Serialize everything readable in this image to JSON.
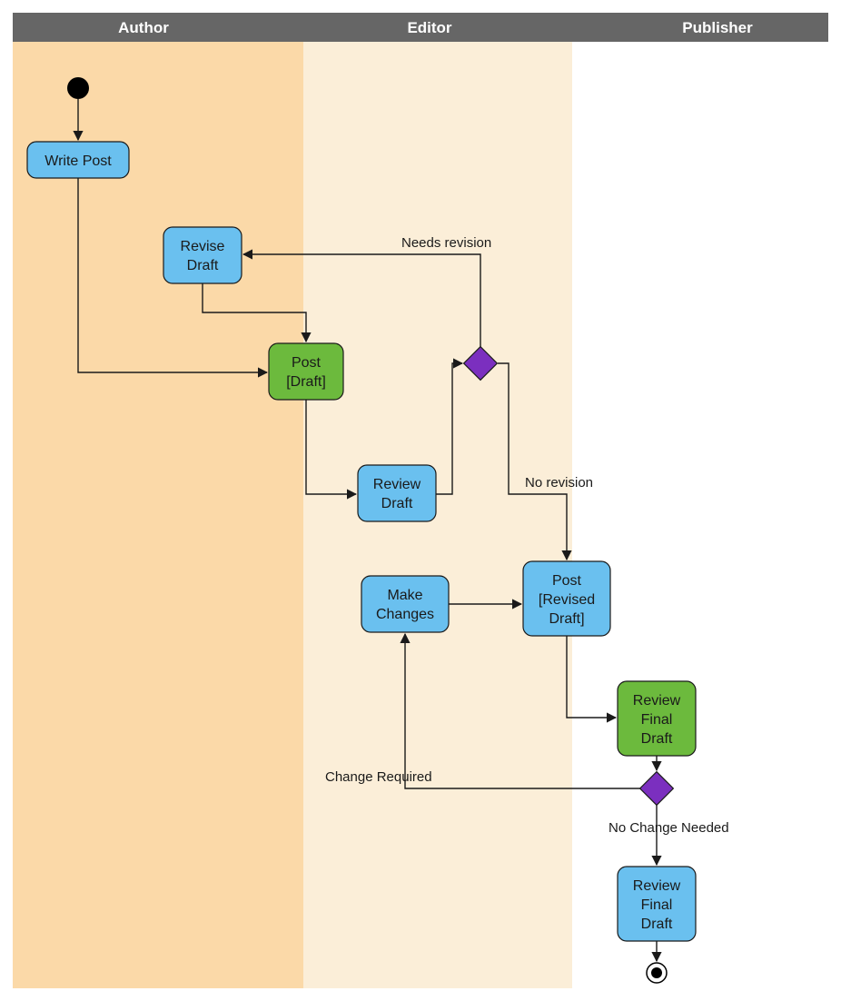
{
  "swimlanes": {
    "author": {
      "label": "Author"
    },
    "editor": {
      "label": "Editor"
    },
    "publisher": {
      "label": "Publisher"
    }
  },
  "nodes": {
    "write_post": {
      "label": "Write Post"
    },
    "revise_draft": {
      "label1": "Revise",
      "label2": "Draft"
    },
    "post_draft": {
      "label1": "Post",
      "label2": "[Draft]"
    },
    "review_draft": {
      "label1": "Review",
      "label2": "Draft"
    },
    "make_changes": {
      "label1": "Make",
      "label2": "Changes"
    },
    "post_revised": {
      "label1": "Post",
      "label2": "[Revised",
      "label3": "Draft]"
    },
    "review_final": {
      "label1": "Review",
      "label2": "Final",
      "label3": "Draft"
    },
    "review_final2": {
      "label1": "Review",
      "label2": "Final",
      "label3": "Draft"
    }
  },
  "edges": {
    "needs_revision": {
      "label": "Needs revision"
    },
    "no_revision": {
      "label": "No revision"
    },
    "change_required": {
      "label": "Change Required"
    },
    "no_change_needed": {
      "label": "No Change Needed"
    }
  },
  "chart_data": {
    "type": "swimlane-activity-diagram",
    "lanes": [
      "Author",
      "Editor",
      "Publisher"
    ],
    "start": {
      "lane": "Author"
    },
    "activities": [
      {
        "id": "write_post",
        "label": "Write Post",
        "lane": "Author",
        "color": "blue"
      },
      {
        "id": "revise_draft",
        "label": "Revise Draft",
        "lane": "Author",
        "color": "blue"
      },
      {
        "id": "post_draft",
        "label": "Post [Draft]",
        "lane": "Author/Editor",
        "color": "green"
      },
      {
        "id": "review_draft",
        "label": "Review Draft",
        "lane": "Editor",
        "color": "blue"
      },
      {
        "id": "decision1",
        "type": "decision",
        "lane": "Editor"
      },
      {
        "id": "make_changes",
        "label": "Make Changes",
        "lane": "Editor",
        "color": "blue"
      },
      {
        "id": "post_revised",
        "label": "Post [Revised Draft]",
        "lane": "Editor",
        "color": "blue"
      },
      {
        "id": "review_final",
        "label": "Review Final Draft",
        "lane": "Publisher",
        "color": "green"
      },
      {
        "id": "decision2",
        "type": "decision",
        "lane": "Publisher"
      },
      {
        "id": "review_final2",
        "label": "Review Final Draft",
        "lane": "Publisher",
        "color": "blue"
      }
    ],
    "transitions": [
      {
        "from": "start",
        "to": "write_post"
      },
      {
        "from": "write_post",
        "to": "post_draft"
      },
      {
        "from": "revise_draft",
        "to": "post_draft"
      },
      {
        "from": "post_draft",
        "to": "review_draft"
      },
      {
        "from": "review_draft",
        "to": "decision1"
      },
      {
        "from": "decision1",
        "to": "revise_draft",
        "label": "Needs revision"
      },
      {
        "from": "decision1",
        "to": "post_revised",
        "label": "No revision"
      },
      {
        "from": "make_changes",
        "to": "post_revised"
      },
      {
        "from": "post_revised",
        "to": "review_final"
      },
      {
        "from": "review_final",
        "to": "decision2"
      },
      {
        "from": "decision2",
        "to": "make_changes",
        "label": "Change Required"
      },
      {
        "from": "decision2",
        "to": "review_final2",
        "label": "No Change Needed"
      },
      {
        "from": "review_final2",
        "to": "end"
      }
    ],
    "end": {
      "lane": "Publisher"
    }
  }
}
